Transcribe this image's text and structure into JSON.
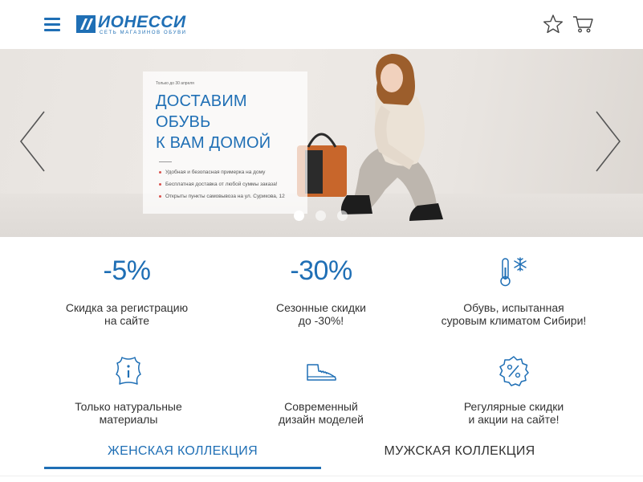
{
  "header": {
    "logo_name": "ИОНЕССИ",
    "logo_subtitle": "СЕТЬ МАГАЗИНОВ ОБУВИ",
    "menu_icon": "hamburger-icon",
    "favorites_icon": "star-icon",
    "cart_icon": "cart-icon",
    "brand_color": "#1f6fb5"
  },
  "hero": {
    "note": "Только до 30 апреля",
    "title_line1": "ДОСТАВИМ ОБУВЬ",
    "title_line2": "К ВАМ ДОМОЙ",
    "bullets": [
      "Удобная и безопасная примерка на дому",
      "Бесплатная доставка от любой суммы заказа!",
      "Открыты пункты самовывоза на ул. Сурикова, 12"
    ],
    "slides_total": 3,
    "active_slide": 1,
    "prev_icon": "chevron-left-icon",
    "next_icon": "chevron-right-icon"
  },
  "features": [
    {
      "big": "-5%",
      "text": "Скидка за регистрацию\nна сайте"
    },
    {
      "big": "-30%",
      "text": "Сезонные скидки\nдо -30%!"
    },
    {
      "icon": "thermometer-snowflake-icon",
      "text": "Обувь, испытанная\nсуровым климатом Сибири!"
    },
    {
      "icon": "leather-icon",
      "text": "Только натуральные\nматериалы"
    },
    {
      "icon": "shoe-icon",
      "text": "Современный\nдизайн моделей"
    },
    {
      "icon": "percent-badge-icon",
      "text": "Регулярные скидки\nи акции на сайте!"
    }
  ],
  "tabs": [
    {
      "label": "ЖЕНСКАЯ КОЛЛЕКЦИЯ",
      "active": true
    },
    {
      "label": "МУЖСКАЯ КОЛЛЕКЦИЯ",
      "active": false
    }
  ]
}
